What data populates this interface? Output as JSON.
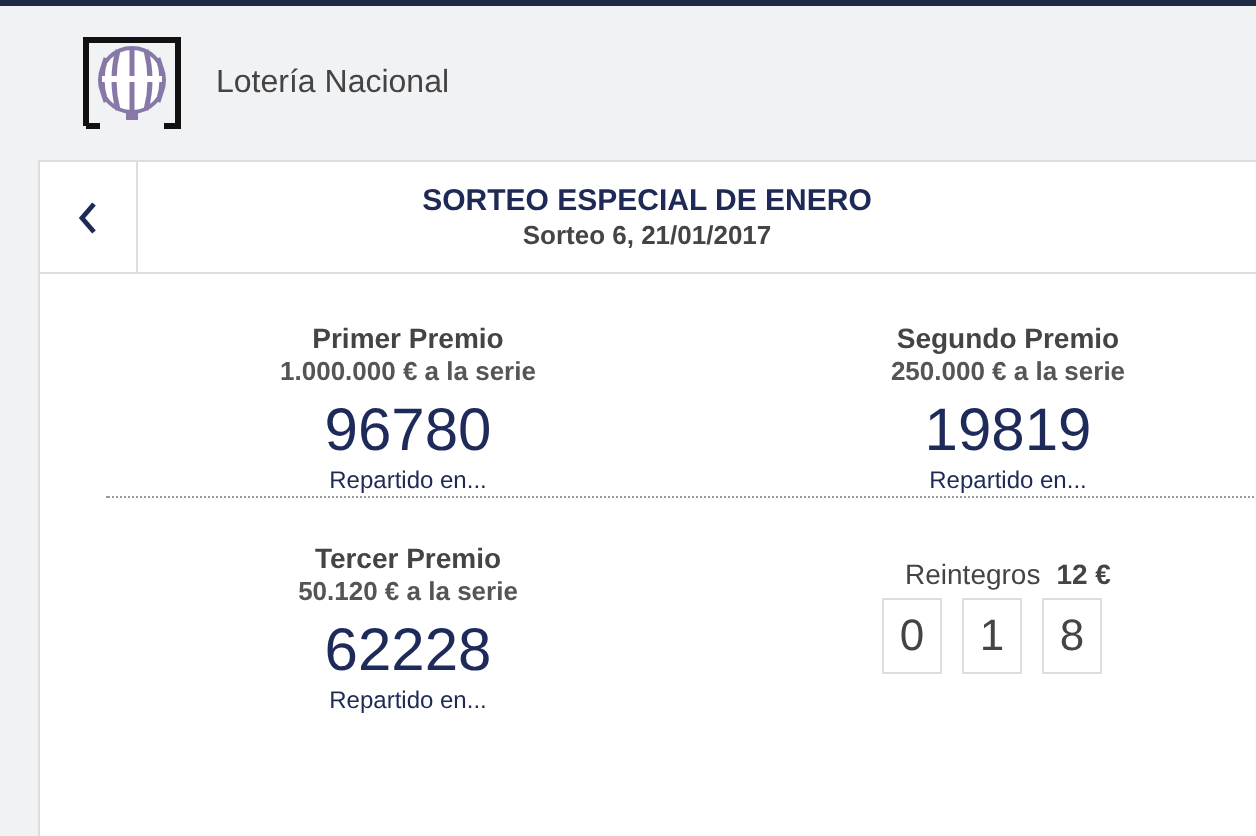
{
  "app": {
    "title": "Lotería Nacional"
  },
  "draw": {
    "title": "SORTEO ESPECIAL DE ENERO",
    "subtitle": "Sorteo 6, 21/01/2017"
  },
  "prizes": [
    {
      "name": "Primer Premio",
      "amount": "1.000.000 € a la serie",
      "number": "96780",
      "link": "Repartido en..."
    },
    {
      "name": "Segundo Premio",
      "amount": "250.000 € a la serie",
      "number": "19819",
      "link": "Repartido en..."
    },
    {
      "name": "Tercer Premio",
      "amount": "50.120 € a la serie",
      "number": "62228",
      "link": "Repartido en..."
    }
  ],
  "reintegros": {
    "label": "Reintegros",
    "amount": "12 €",
    "digits": [
      "0",
      "1",
      "8"
    ]
  }
}
